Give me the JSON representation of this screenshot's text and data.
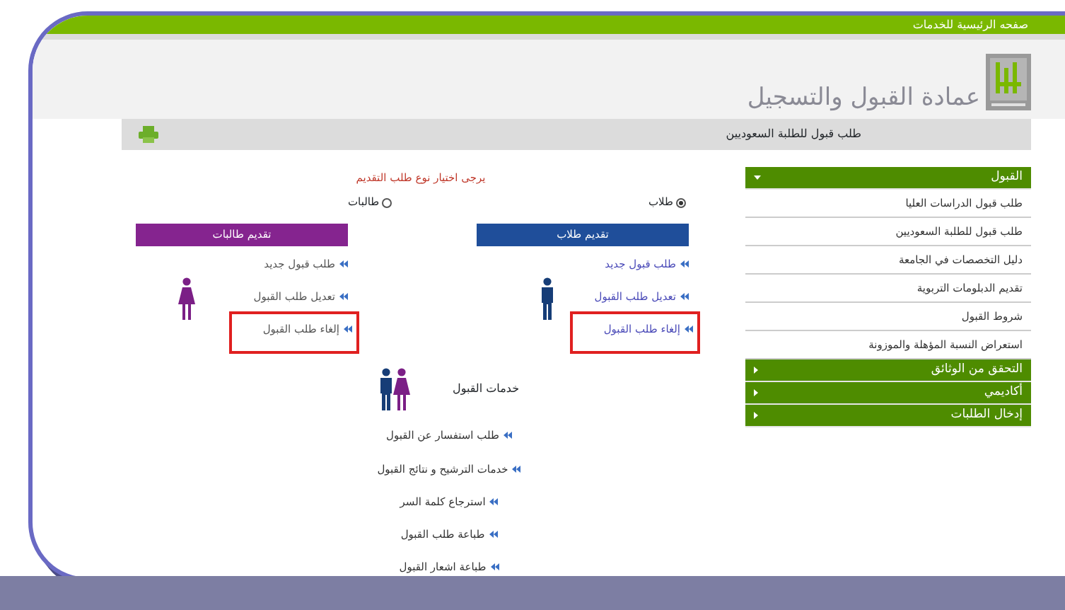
{
  "top_bar": {
    "link": "صفحه الرئيسية للخدمات"
  },
  "header": {
    "title": "عمادة القبول والتسجيل"
  },
  "breadcrumb_bar": {
    "link": "طلب قبول للطلبة السعوديين"
  },
  "sidebar": {
    "sections": [
      {
        "label": "القبول",
        "expanded": true,
        "items": [
          "طلب قبول الدراسات العليا",
          "طلب قبول للطلبة السعوديين",
          "دليل التخصصات في الجامعة",
          "تقديم الدبلومات التربوية",
          "شروط القبول",
          "استعراض النسبة المؤهلة والموزونة"
        ]
      },
      {
        "label": "التحقق من الوثائق",
        "expanded": false
      },
      {
        "label": "أكاديمي",
        "expanded": false
      },
      {
        "label": "إدخال الطلبات",
        "expanded": false
      }
    ]
  },
  "content": {
    "prompt": "يرجى اختيار نوع طلب التقديم",
    "options": [
      {
        "label": "طلاب",
        "selected": true
      },
      {
        "label": "طالبات",
        "selected": false
      }
    ],
    "panels": [
      {
        "kind": "male",
        "title": "تقديم طلاب",
        "links": [
          {
            "label": "طلب قبول جديد",
            "highlighted": false
          },
          {
            "label": "تعديل طلب القبول",
            "highlighted": false
          },
          {
            "label": "إلغاء طلب القبول",
            "highlighted": true
          }
        ]
      },
      {
        "kind": "female",
        "title": "تقديم طالبات",
        "links": [
          {
            "label": "طلب قبول جديد",
            "highlighted": false
          },
          {
            "label": "تعديل طلب القبول",
            "highlighted": false
          },
          {
            "label": "إلغاء طلب القبول",
            "highlighted": true
          }
        ]
      }
    ],
    "services": {
      "title": "خدمات القبول",
      "links": [
        "طلب استفسار عن القبول",
        "خدمات الترشيح و نتائج القبول",
        "استرجاع كلمة السر",
        "طباعة طلب القبول",
        "طباعة اشعار القبول"
      ]
    }
  }
}
